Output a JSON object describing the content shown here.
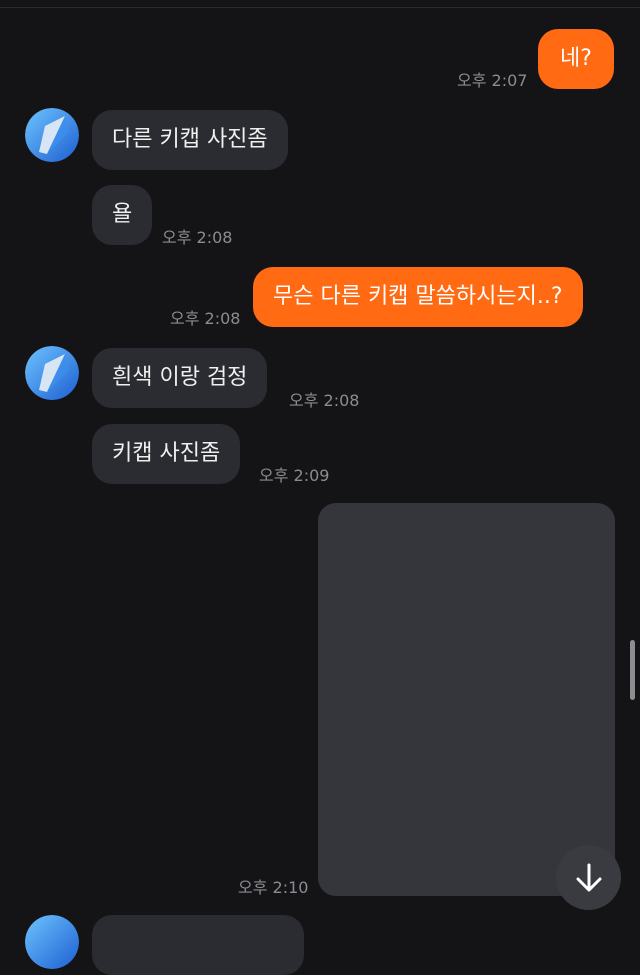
{
  "messages": [
    {
      "from": "me",
      "text": "네?",
      "time": "오후 2:07"
    },
    {
      "from": "other",
      "text": "다른 키캡 사진좀"
    },
    {
      "from": "other",
      "text": "욜",
      "time": "오후 2:08"
    },
    {
      "from": "me",
      "text": "무슨 다른 키캡 말씀하시는지..?",
      "time": "오후 2:08"
    },
    {
      "from": "other",
      "text": "흰색 이랑 검정",
      "time": "오후 2:08"
    },
    {
      "from": "other",
      "text": "키캡 사진좀",
      "time": "오후 2:09"
    },
    {
      "from": "me",
      "type": "image",
      "time": "오후 2:10"
    }
  ],
  "colors": {
    "background": "#141417",
    "sent_bubble": "#ff6a13",
    "received_bubble": "#2b2c31",
    "timestamp": "#8a8c92"
  },
  "icons": {
    "avatar": "blue-gradient-avatar-icon",
    "scroll_down": "arrow-down-icon"
  }
}
